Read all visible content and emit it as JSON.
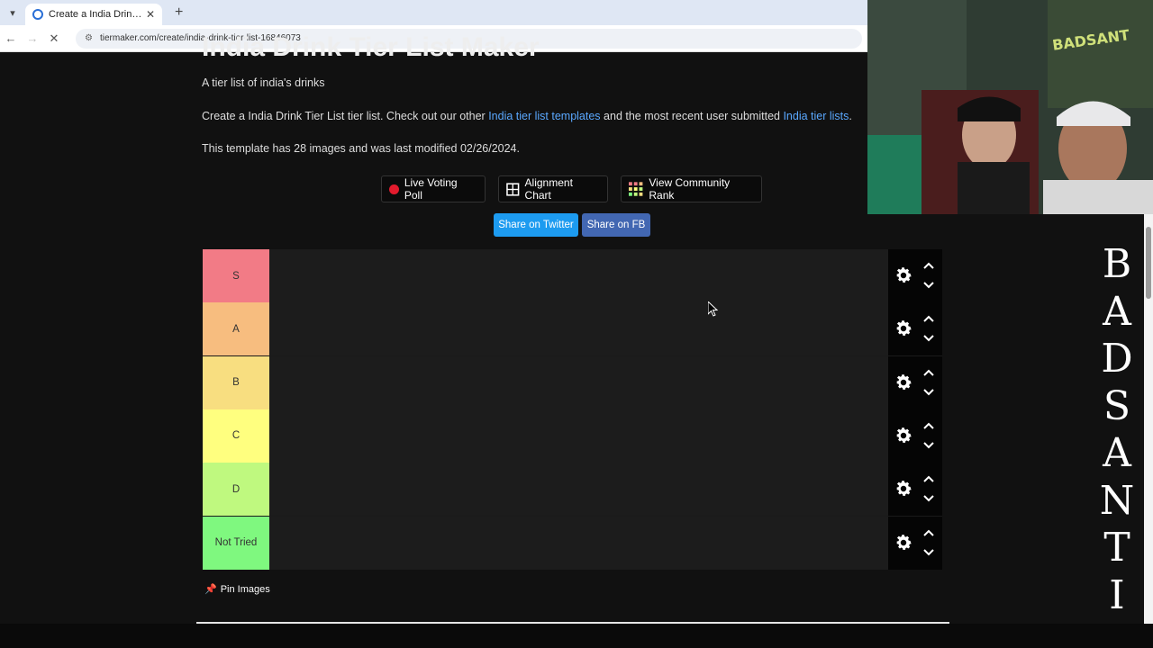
{
  "browser": {
    "tab_title": "Create a India Drink Tier List - Tie",
    "url": "tiermaker.com/create/india-drink-tier-list-16846073"
  },
  "page": {
    "title": "India Drink Tier List Maker",
    "subtitle": "A tier list of india's drinks",
    "intro_pre": "Create a India Drink Tier List tier list. Check out our other ",
    "intro_link1": "India tier list templates",
    "intro_mid": " and the most recent user submitted ",
    "intro_link2": "India tier lists",
    "intro_post": ".",
    "meta": "This template has 28 images and was last modified 02/26/2024."
  },
  "buttons": {
    "voting": "Live Voting Poll",
    "alignment": "Alignment Chart",
    "community": "View Community Rank",
    "twitter": "Share on Twitter",
    "fb": "Share on FB"
  },
  "tiers": [
    {
      "label": "S",
      "color": "#f27b86"
    },
    {
      "label": "A",
      "color": "#f7bd7f"
    },
    {
      "label": "B",
      "color": "#f8de80"
    },
    {
      "label": "C",
      "color": "#ffff7f"
    },
    {
      "label": "D",
      "color": "#bff97f"
    },
    {
      "label": "Not Tried",
      "color": "#7ff87f"
    }
  ],
  "pin_label": "Pin Images",
  "banner_letters": [
    "B",
    "A",
    "D",
    "S",
    "A",
    "N",
    "T",
    "I"
  ],
  "webcam_sign": "BADSANT"
}
